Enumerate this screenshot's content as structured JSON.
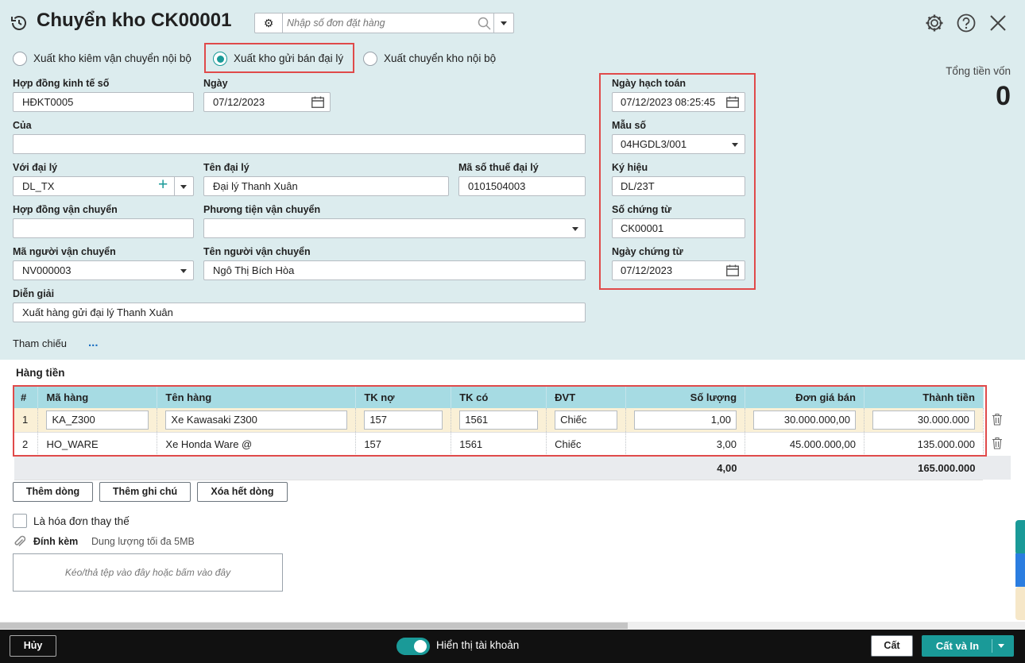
{
  "header": {
    "title": "Chuyển kho CK00001",
    "search_placeholder": "Nhập số đơn đặt hàng"
  },
  "radio_options": [
    {
      "label": "Xuất kho kiêm vận chuyển nội bộ",
      "selected": false
    },
    {
      "label": "Xuất kho gửi bán đại lý",
      "selected": true
    },
    {
      "label": "Xuất chuyển kho nội bộ",
      "selected": false
    }
  ],
  "summary": {
    "label": "Tổng tiền vốn",
    "value": "0"
  },
  "form": {
    "hop_dong_kinh_te": {
      "label": "Hợp đồng kinh tế số",
      "value": "HĐKT0005"
    },
    "ngay": {
      "label": "Ngày",
      "value": "07/12/2023"
    },
    "cua": {
      "label": "Của",
      "value": ""
    },
    "voi_dai_ly": {
      "label": "Với đại lý",
      "value": "DL_TX"
    },
    "ten_dai_ly": {
      "label": "Tên đại lý",
      "value": "Đại lý Thanh Xuân"
    },
    "ma_so_thue": {
      "label": "Mã số thuế đại lý",
      "value": "0101504003"
    },
    "hop_dong_van_chuyen": {
      "label": "Hợp đồng vận chuyển",
      "value": ""
    },
    "phuong_tien": {
      "label": "Phương tiện vận chuyển",
      "value": ""
    },
    "ma_nguoi_van_chuyen": {
      "label": "Mã người vận chuyển",
      "value": "NV000003"
    },
    "ten_nguoi_van_chuyen": {
      "label": "Tên người vận chuyển",
      "value": "Ngô Thị Bích Hòa"
    },
    "dien_giai": {
      "label": "Diễn giải",
      "value": "Xuất hàng gửi đại lý Thanh Xuân"
    },
    "tham_chieu": {
      "label": "Tham chiếu",
      "value": "..."
    }
  },
  "voucher": {
    "ngay_hach_toan": {
      "label": "Ngày hạch toán",
      "value": "07/12/2023 08:25:45"
    },
    "mau_so": {
      "label": "Mẫu số",
      "value": "04HGDL3/001"
    },
    "ky_hieu": {
      "label": "Ký hiệu",
      "value": "DL/23T"
    },
    "so_chung_tu": {
      "label": "Số chứng từ",
      "value": "CK00001"
    },
    "ngay_chung_tu": {
      "label": "Ngày chứng từ",
      "value": "07/12/2023"
    }
  },
  "grid": {
    "section_title": "Hàng tiền",
    "columns": [
      "#",
      "Mã hàng",
      "Tên hàng",
      "TK nợ",
      "TK có",
      "ĐVT",
      "Số lượng",
      "Đơn giá bán",
      "Thành tiền"
    ],
    "rows": [
      [
        "1",
        "KA_Z300",
        "Xe Kawasaki Z300",
        "157",
        "1561",
        "Chiếc",
        "1,00",
        "30.000.000,00",
        "30.000.000"
      ],
      [
        "2",
        "HO_WARE",
        "Xe Honda Ware @",
        "157",
        "1561",
        "Chiếc",
        "3,00",
        "45.000.000,00",
        "135.000.000"
      ]
    ],
    "totals": {
      "quantity": "4,00",
      "amount": "165.000.000"
    }
  },
  "buttons": {
    "add_row": "Thêm dòng",
    "add_note": "Thêm ghi chú",
    "delete_all": "Xóa hết dòng"
  },
  "replacement_invoice": {
    "label": "Là hóa đơn thay thế",
    "checked": false
  },
  "attachment": {
    "label": "Đính kèm",
    "hint": "Dung lượng tối đa 5MB",
    "dropzone": "Kéo/thả tệp vào đây hoặc bấm vào đây"
  },
  "footer": {
    "cancel": "Hủy",
    "toggle_label": "Hiển thị tài khoản",
    "toggle_on": true,
    "save": "Cất",
    "save_print": "Cất và In"
  },
  "colors": {
    "accent": "#1a9a98",
    "highlight": "#e04a4a",
    "header_bg": "#dcecee",
    "grid_header": "#a6dbe3"
  }
}
